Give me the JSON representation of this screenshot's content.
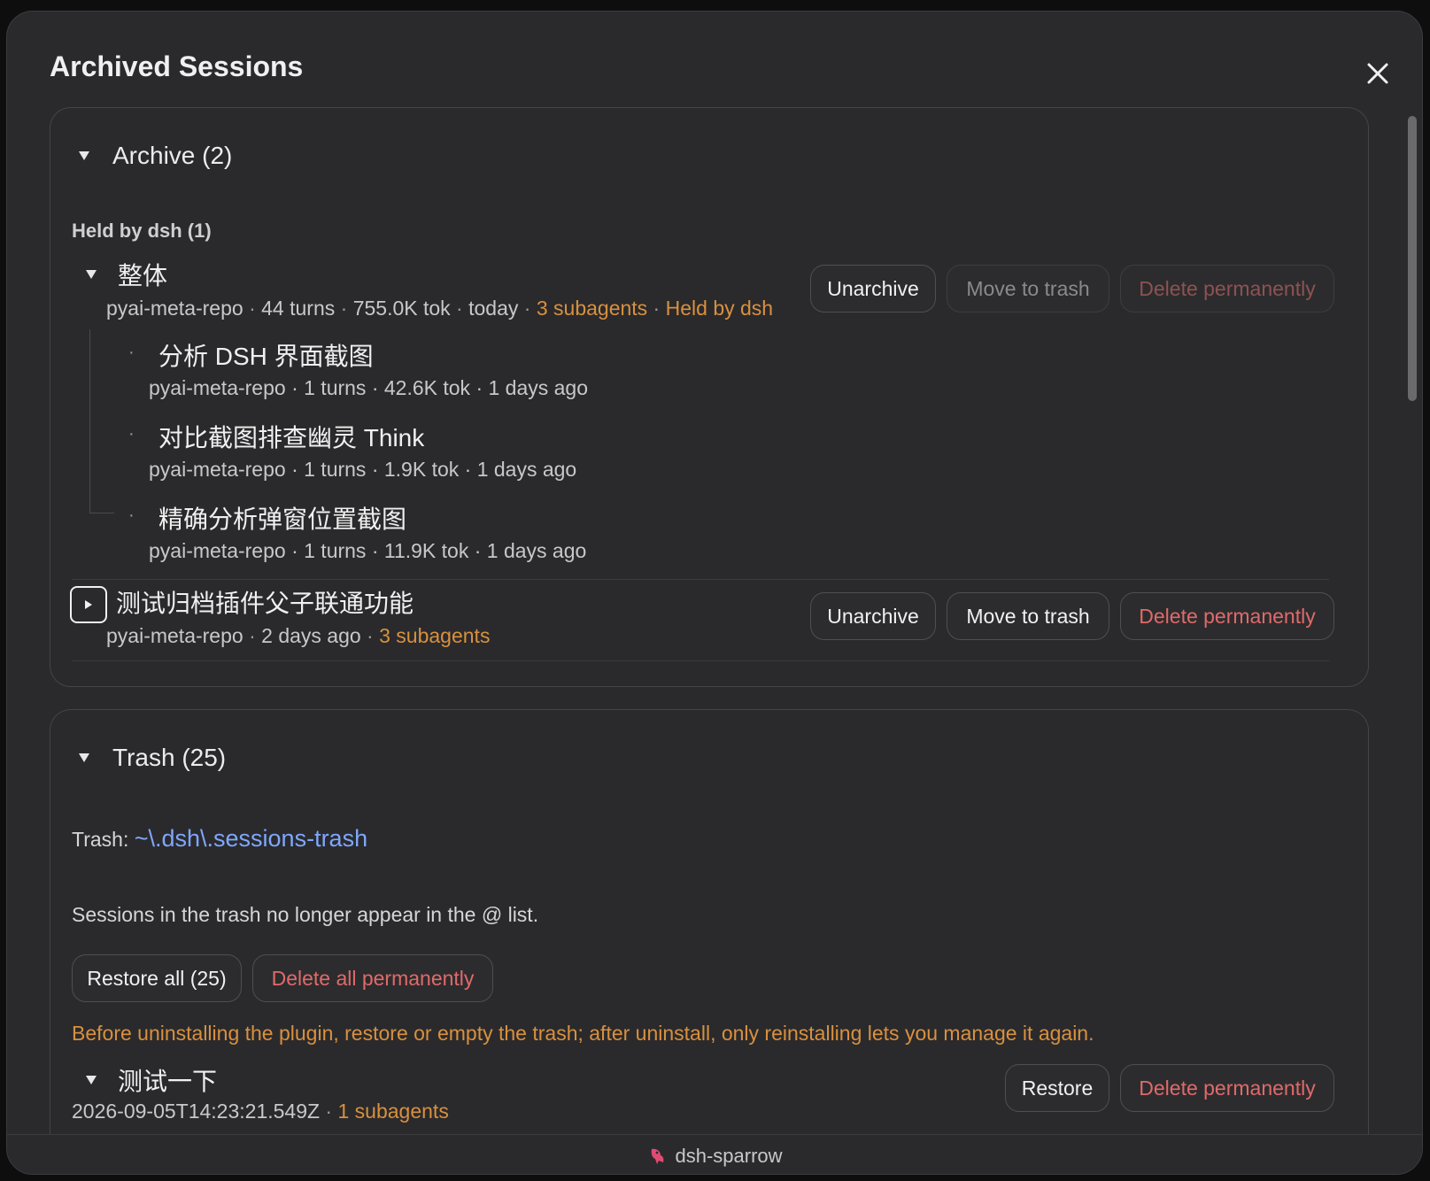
{
  "dialog": {
    "title": "Archived Sessions"
  },
  "archive": {
    "header": "Archive (2)",
    "held_header": "Held by dsh (1)",
    "sessions": [
      {
        "title": "整体",
        "repo": "pyai-meta-repo",
        "turns": "44 turns",
        "tokens": "755.0K tok",
        "when": "today",
        "subagents": "3 subagents",
        "held": "Held by dsh",
        "children": [
          {
            "title": "分析 DSH 界面截图",
            "meta": "pyai-meta-repo · 1 turns · 42.6K tok · 1 days ago"
          },
          {
            "title": "对比截图排查幽灵 Think",
            "meta": "pyai-meta-repo · 1 turns · 1.9K tok · 1 days ago"
          },
          {
            "title": "精确分析弹窗位置截图",
            "meta": "pyai-meta-repo · 1 turns · 11.9K tok · 1 days ago"
          }
        ]
      },
      {
        "title": "测试归档插件父子联通功能",
        "repo": "pyai-meta-repo",
        "when": "2 days ago",
        "subagents": "3 subagents"
      }
    ],
    "buttons": {
      "unarchive": "Unarchive",
      "move_to_trash": "Move to trash",
      "delete_permanently": "Delete permanently"
    }
  },
  "trash": {
    "header": "Trash (25)",
    "path_label": "Trash:",
    "path": "~\\.dsh\\.sessions-trash",
    "description": "Sessions in the trash no longer appear in the @ list.",
    "restore_all": "Restore all (25)",
    "delete_all": "Delete all permanently",
    "warning": "Before uninstalling the plugin, restore or empty the trash; after uninstall, only reinstalling lets you manage it again.",
    "sessions": [
      {
        "title": "测试一下",
        "meta_date": "2026-09-05T14:23:21.549Z",
        "subagents": "1 subagents"
      }
    ],
    "buttons": {
      "restore": "Restore",
      "delete_permanently": "Delete permanently"
    }
  },
  "footer": {
    "app_name": "dsh-sparrow"
  },
  "colors": {
    "accent_orange": "#d9903f",
    "link_blue": "#7fa7ff",
    "danger_red": "#e06a6a"
  },
  "icons": {
    "close": "close-icon",
    "footer": "sparrow-icon"
  }
}
